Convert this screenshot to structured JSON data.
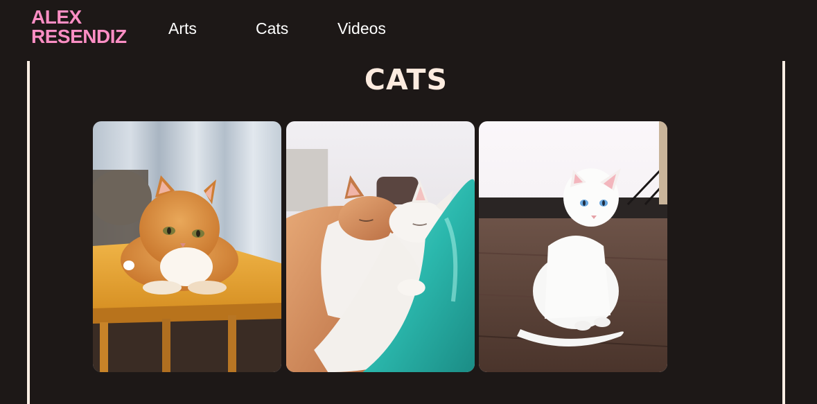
{
  "brand": {
    "line1": "ALEX",
    "line2": "RESENDIZ",
    "color": "#fc8ec4"
  },
  "nav": {
    "items": [
      {
        "label": "Arts"
      },
      {
        "label": "Cats"
      },
      {
        "label": "Videos"
      }
    ]
  },
  "page": {
    "title": "CATS"
  },
  "gallery": {
    "photos": [
      {
        "subject": "orange tabby cat lying on a wooden chair"
      },
      {
        "subject": "orange tabby and white cat cuddling asleep"
      },
      {
        "subject": "white cat with blue eyes sitting on wooden floor"
      }
    ]
  },
  "colors": {
    "background": "#1d1817",
    "frame": "#fbeee4",
    "title": "#fcebdf",
    "nav_text": "#ffffff"
  }
}
